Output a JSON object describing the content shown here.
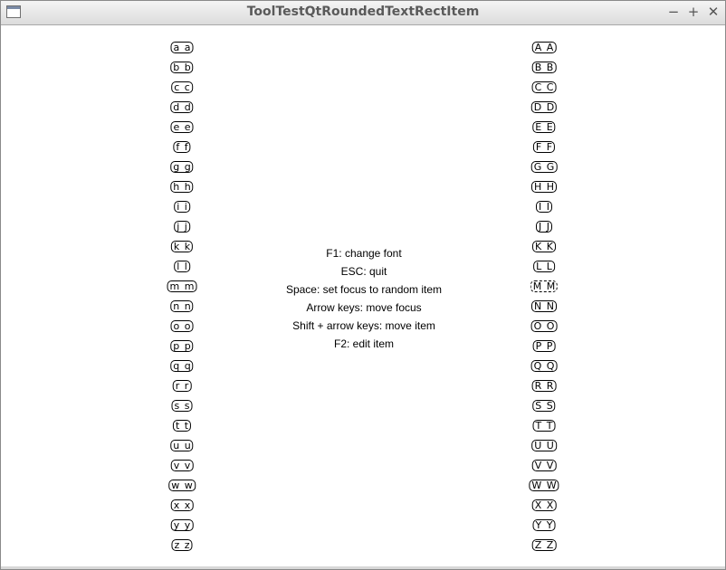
{
  "window": {
    "title": "ToolTestQtRoundedTextRectItem",
    "icon": "window-icon",
    "buttons": {
      "minimize": "−",
      "maximize": "+",
      "close": "✕"
    }
  },
  "left_items": [
    "a a",
    "b b",
    "c c",
    "d d",
    "e e",
    "f f",
    "g g",
    "h h",
    "i i",
    "j j",
    "k k",
    "l l",
    "m m",
    "n n",
    "o o",
    "p p",
    "q q",
    "r r",
    "s s",
    "t t",
    "u u",
    "v v",
    "w w",
    "x x",
    "y y",
    "z z"
  ],
  "right_items": [
    "A A",
    "B B",
    "C C",
    "D D",
    "E E",
    "F F",
    "G G",
    "H H",
    "I I",
    "J J",
    "K K",
    "L L",
    "M M",
    "N N",
    "O O",
    "P P",
    "Q Q",
    "R R",
    "S S",
    "T T",
    "U U",
    "V V",
    "W W",
    "X X",
    "Y Y",
    "Z Z"
  ],
  "focused_item": "M M",
  "instructions": [
    "F1: change font",
    "ESC: quit",
    "Space: set focus to random item",
    "Arrow keys: move focus",
    "Shift + arrow keys: move item",
    "F2: edit item"
  ]
}
